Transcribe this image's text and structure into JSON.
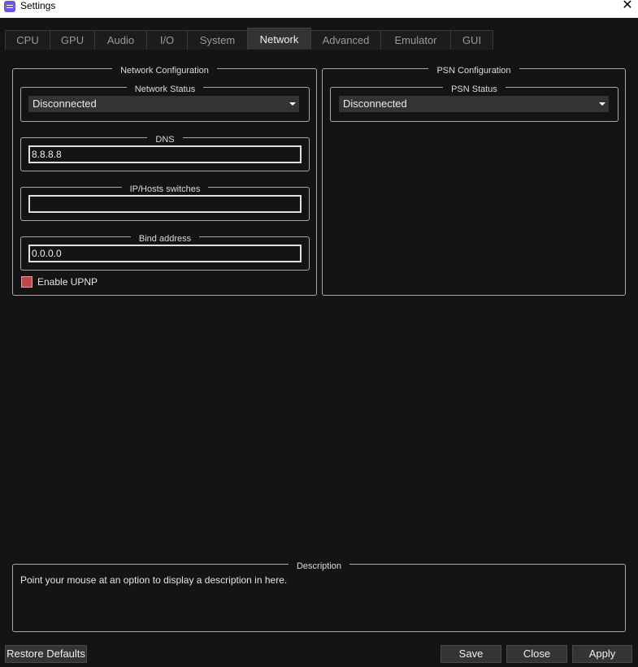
{
  "window": {
    "title": "Settings",
    "close_glyph": "✕"
  },
  "tabs": [
    {
      "label": "CPU",
      "active": false
    },
    {
      "label": "GPU",
      "active": false
    },
    {
      "label": "Audio",
      "active": false
    },
    {
      "label": "I/O",
      "active": false
    },
    {
      "label": "System",
      "active": false
    },
    {
      "label": "Network",
      "active": true
    },
    {
      "label": "Advanced",
      "active": false
    },
    {
      "label": "Emulator",
      "active": false
    },
    {
      "label": "GUI",
      "active": false
    }
  ],
  "network_config": {
    "title": "Network Configuration",
    "status": {
      "title": "Network Status",
      "value": "Disconnected"
    },
    "dns": {
      "title": "DNS",
      "value": "8.8.8.8"
    },
    "ip_hosts": {
      "title": "IP/Hosts switches",
      "value": ""
    },
    "bind": {
      "title": "Bind address",
      "value": "0.0.0.0"
    },
    "upnp": {
      "label": "Enable UPNP",
      "checked": false,
      "color": "#c04848"
    }
  },
  "psn_config": {
    "title": "PSN Configuration",
    "status": {
      "title": "PSN Status",
      "value": "Disconnected"
    }
  },
  "description": {
    "title": "Description",
    "text": "Point your mouse at an option to display a description in here."
  },
  "buttons": {
    "restore": "Restore Defaults",
    "save": "Save",
    "close": "Close",
    "apply": "Apply"
  }
}
